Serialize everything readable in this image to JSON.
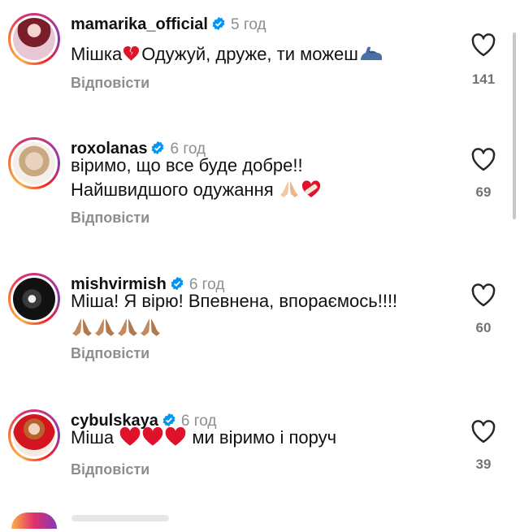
{
  "comments": [
    {
      "username": "mamarika_official",
      "time": "5 год",
      "lines": [
        "Мішка",
        "Одужуй, друже, ти можеш"
      ],
      "reply": "Відповісти",
      "likes": "141"
    },
    {
      "username": "roxolanas",
      "time": "6 год",
      "lines": [
        "віримо, що все буде добре!!",
        "Найшвидшого одужання"
      ],
      "reply": "Відповісти",
      "likes": "69"
    },
    {
      "username": "mishvirmish",
      "time": "6 год",
      "lines": [
        "Міша! Я вірю! Впевнена, впораємось!!!!"
      ],
      "reply": "Відповісти",
      "likes": "60"
    },
    {
      "username": "cybulskaya",
      "time": "6 год",
      "lines": [
        "Міша",
        "ми віримо і поруч"
      ],
      "reply": "Відповісти",
      "likes": "39"
    }
  ],
  "colors": {
    "verified": "#0095f6",
    "muted": "#8e8e8e",
    "heart_red": "#e0112b"
  },
  "icons": {
    "verified": "verified-badge-icon",
    "like": "heart-outline-icon"
  }
}
